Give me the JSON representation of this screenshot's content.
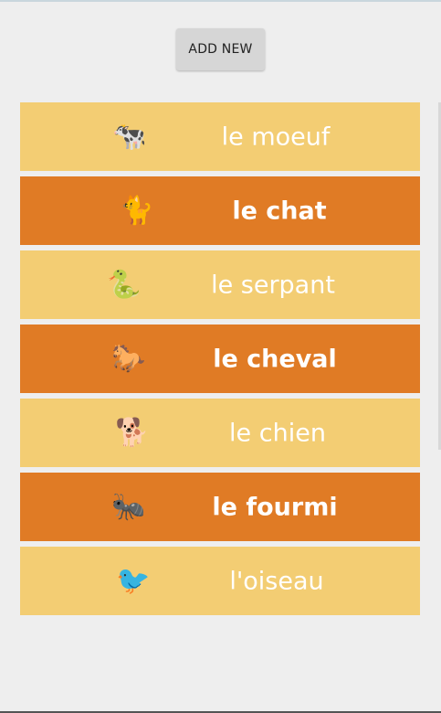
{
  "toolbar": {
    "add_new_label": "ADD NEW"
  },
  "colors": {
    "light_row": "#f3cd73",
    "dark_row": "#e07b25",
    "label_text": "#ffffff"
  },
  "animals": [
    {
      "icon": "cow-icon",
      "glyph": "🐄",
      "label": "le moeuf",
      "shade": "light"
    },
    {
      "icon": "cat-icon",
      "glyph": "🐈",
      "label": "le chat",
      "shade": "dark"
    },
    {
      "icon": "snake-icon",
      "glyph": "🐍",
      "label": "le serpant",
      "shade": "light"
    },
    {
      "icon": "horse-icon",
      "glyph": "🐎",
      "label": "le cheval",
      "shade": "dark"
    },
    {
      "icon": "dog-icon",
      "glyph": "🐕",
      "label": "le chien",
      "shade": "light"
    },
    {
      "icon": "ant-icon",
      "glyph": "🐜",
      "label": "le fourmi",
      "shade": "dark"
    },
    {
      "icon": "bird-icon",
      "glyph": "🐦",
      "label": "l'oiseau",
      "shade": "light"
    }
  ]
}
